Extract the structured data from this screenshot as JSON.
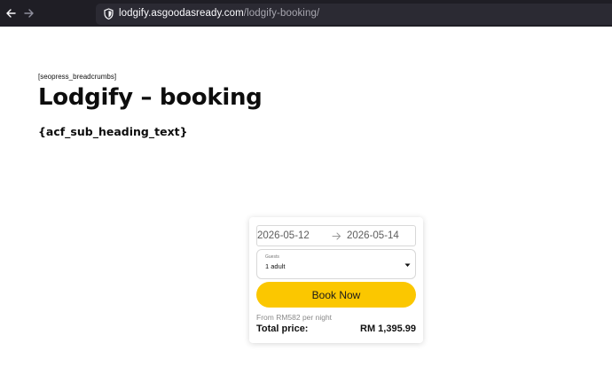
{
  "browser": {
    "url_domain": "lodgify.asgoodasready.com",
    "url_path": "/lodgify-booking/"
  },
  "page": {
    "breadcrumbs": "[seopress_breadcrumbs]",
    "title": "Lodgify – booking",
    "sub_heading": "{acf_sub_heading_text}"
  },
  "widget": {
    "check_in": "2026-05-12",
    "check_out": "2026-05-14",
    "guests_label": "Guests",
    "guests_value": "1 adult",
    "book_label": "Book Now",
    "from_price": "From RM582 per night",
    "total_label": "Total price:",
    "total_value": "RM 1,395.99"
  },
  "colors": {
    "browser_bg": "#1f1e25",
    "url_bg": "#2b2a33",
    "book_button": "#fbc700"
  },
  "icons": [
    "back-arrow-icon",
    "forward-arrow-icon",
    "shield-icon",
    "arrow-right-icon",
    "chevron-down-icon"
  ]
}
